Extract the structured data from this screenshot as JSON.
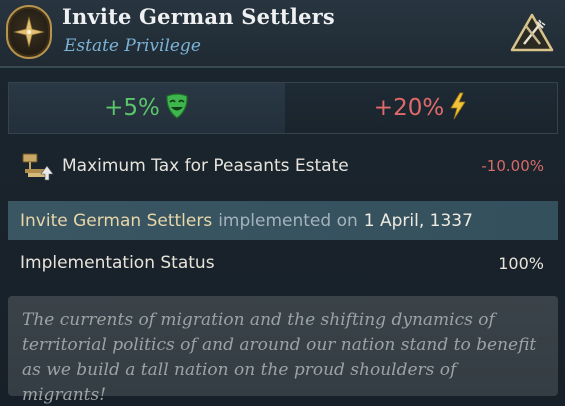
{
  "header": {
    "title": "Invite German Settlers",
    "subtitle": "Estate Privilege",
    "emblem_icon": "compass-star-icon",
    "corner_icon": "pitchfork-triangle-icon"
  },
  "modifiers": {
    "left": {
      "value": "+5%",
      "icon": "happy-mask-icon",
      "color": "#5ac56a"
    },
    "right": {
      "value": "+20%",
      "icon": "lightning-icon",
      "color": "#e06a6a"
    }
  },
  "tax": {
    "icon": "scales-arrow-icon",
    "label": "Maximum Tax for Peasants Estate",
    "value": "-10.00%"
  },
  "implemented": {
    "name": "Invite German Settlers",
    "middle": "implemented on",
    "date": "1 April, 1337"
  },
  "status": {
    "label": "Implementation Status",
    "value": "100%"
  },
  "description": "The currents of migration and the shifting dynamics of territorial politics of and around our nation stand to benefit as we build a tall nation on the proud shoulders of migrants!"
}
